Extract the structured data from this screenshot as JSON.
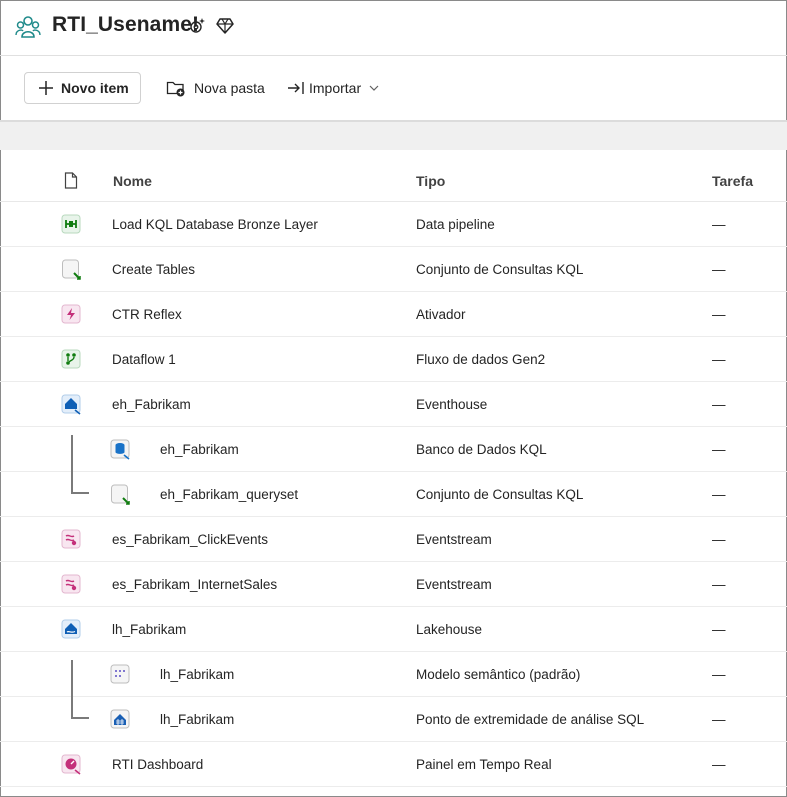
{
  "workspace": {
    "title": "RTI_Usename!",
    "icons": [
      "workspace-people-icon",
      "settings-sparkle-icon",
      "premium-diamond-icon"
    ]
  },
  "toolbar": {
    "new_item_label": "Novo item",
    "new_folder_label": "Nova pasta",
    "import_label": "Importar"
  },
  "table": {
    "headers": {
      "type_icon": "file-icon",
      "name": "Nome",
      "type": "Tipo",
      "task": "Tarefa"
    },
    "rows": [
      {
        "name": "Load KQL Database Bronze Layer",
        "type": "Data pipeline",
        "task": "—",
        "icon": "pipeline-icon",
        "level": 0
      },
      {
        "name": "Create Tables",
        "type": "Conjunto de Consultas KQL",
        "task": "—",
        "icon": "kql-queryset-icon",
        "level": 0
      },
      {
        "name": "CTR Reflex",
        "type": "Ativador",
        "task": "—",
        "icon": "activator-icon",
        "level": 0
      },
      {
        "name": "Dataflow 1",
        "type": "Fluxo de dados Gen2",
        "task": "—",
        "icon": "dataflow-icon",
        "level": 0
      },
      {
        "name": "eh_Fabrikam",
        "type": "Eventhouse",
        "task": "—",
        "icon": "eventhouse-icon",
        "level": 0
      },
      {
        "name": "eh_Fabrikam",
        "type": "Banco de Dados KQL",
        "task": "—",
        "icon": "kql-database-icon",
        "level": 1
      },
      {
        "name": "eh_Fabrikam_queryset",
        "type": "Conjunto de Consultas KQL",
        "task": "—",
        "icon": "kql-queryset-icon",
        "level": 1
      },
      {
        "name": "es_Fabrikam_ClickEvents",
        "type": "Eventstream",
        "task": "—",
        "icon": "eventstream-icon",
        "level": 0
      },
      {
        "name": "es_Fabrikam_InternetSales",
        "type": "Eventstream",
        "task": "—",
        "icon": "eventstream-icon",
        "level": 0
      },
      {
        "name": "lh_Fabrikam",
        "type": "Lakehouse",
        "task": "—",
        "icon": "lakehouse-icon",
        "level": 0
      },
      {
        "name": "lh_Fabrikam",
        "type": "Modelo semântico (padrão)",
        "task": "—",
        "icon": "semantic-model-icon",
        "level": 1
      },
      {
        "name": "lh_Fabrikam",
        "type": "Ponto de extremidade de análise SQL",
        "task": "—",
        "icon": "sql-endpoint-icon",
        "level": 1
      },
      {
        "name": "RTI Dashboard",
        "type": "Painel em Tempo Real",
        "task": "—",
        "icon": "realtime-dashboard-icon",
        "level": 0
      }
    ]
  }
}
